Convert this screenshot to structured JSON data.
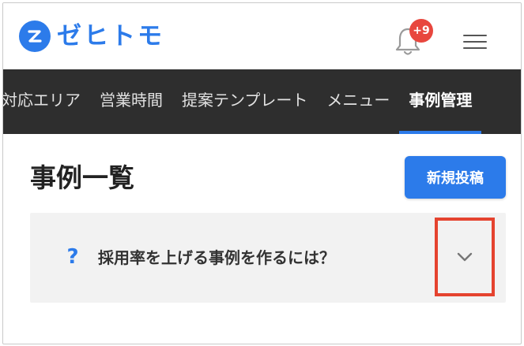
{
  "header": {
    "logo_text": "ゼヒトモ",
    "notification_badge": "+9",
    "icons": [
      "logo-mark-icon",
      "bell-icon",
      "hamburger-menu-icon"
    ]
  },
  "nav": {
    "items": [
      {
        "label": "対応エリア"
      },
      {
        "label": "営業時間"
      },
      {
        "label": "提案テンプレート"
      },
      {
        "label": "メニュー"
      },
      {
        "label": "事例管理",
        "active": true
      }
    ]
  },
  "page": {
    "title": "事例一覧",
    "new_post_label": "新規投稿"
  },
  "faq": {
    "question_mark": "?",
    "question": "採用率を上げる事例を作るには？",
    "expanded": false
  },
  "colors": {
    "brand": "#2c7bea",
    "badge": "#e8473e",
    "nav_bg": "#2e2e2e",
    "highlight_box": "#e5432f"
  }
}
